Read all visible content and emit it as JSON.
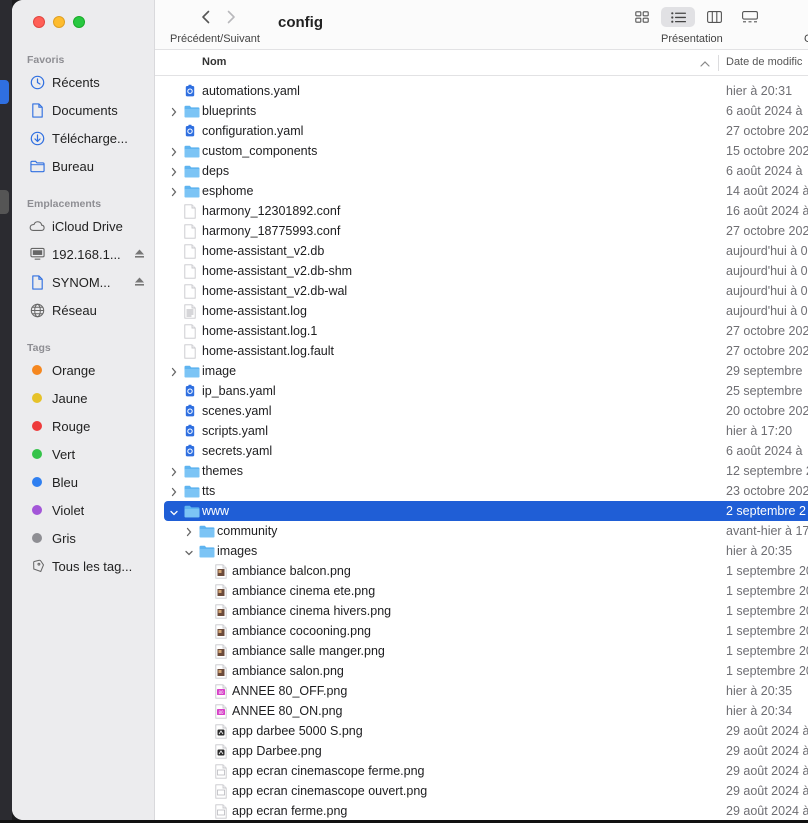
{
  "window": {
    "title": "config"
  },
  "toolbar": {
    "nav_label": "Précédent/Suivant",
    "presentation_label": "Présentation",
    "cut_label": "C",
    "view_modes": [
      {
        "name": "icon-view",
        "selected": false
      },
      {
        "name": "list-view",
        "selected": true
      },
      {
        "name": "column-view",
        "selected": false
      },
      {
        "name": "gallery-view",
        "selected": false
      }
    ]
  },
  "sidebar": {
    "favorites_label": "Favoris",
    "favorites": [
      {
        "label": "Récents",
        "icon": "clock-icon"
      },
      {
        "label": "Documents",
        "icon": "document-icon"
      },
      {
        "label": "Télécharge...",
        "icon": "download-icon"
      },
      {
        "label": "Bureau",
        "icon": "folder-icon"
      }
    ],
    "locations_label": "Emplacements",
    "locations": [
      {
        "label": "iCloud Drive",
        "icon": "cloud-icon",
        "eject": false
      },
      {
        "label": "192.168.1...",
        "icon": "display-icon",
        "eject": true
      },
      {
        "label": "SYNOM...",
        "icon": "document-icon",
        "eject": true
      },
      {
        "label": "Réseau",
        "icon": "globe-icon",
        "eject": false
      }
    ],
    "tags_label": "Tags",
    "tags": [
      {
        "label": "Orange",
        "color": "#f5871f"
      },
      {
        "label": "Jaune",
        "color": "#e6c229"
      },
      {
        "label": "Rouge",
        "color": "#ee3b3b"
      },
      {
        "label": "Vert",
        "color": "#35c34a"
      },
      {
        "label": "Bleu",
        "color": "#2f7ff0"
      },
      {
        "label": "Violet",
        "color": "#a356d8"
      },
      {
        "label": "Gris",
        "color": "#8e8e93"
      }
    ],
    "all_tags_label": "Tous les tag..."
  },
  "columns": {
    "name": "Nom",
    "date": "Date de modific"
  },
  "files": [
    {
      "name": "automations.yaml",
      "date": "hier à 20:31",
      "type": "yaml",
      "level": 0,
      "disc": "none"
    },
    {
      "name": "blueprints",
      "date": "6 août 2024 à",
      "type": "folder",
      "level": 0,
      "disc": "closed"
    },
    {
      "name": "configuration.yaml",
      "date": "27 octobre 202",
      "type": "yaml",
      "level": 0,
      "disc": "none"
    },
    {
      "name": "custom_components",
      "date": "15 octobre 202",
      "type": "folder",
      "level": 0,
      "disc": "closed"
    },
    {
      "name": "deps",
      "date": "6 août 2024 à",
      "type": "folder",
      "level": 0,
      "disc": "closed"
    },
    {
      "name": "esphome",
      "date": "14 août 2024 à",
      "type": "folder",
      "level": 0,
      "disc": "closed"
    },
    {
      "name": "harmony_12301892.conf",
      "date": "16 août 2024 à",
      "type": "file",
      "level": 0,
      "disc": "none"
    },
    {
      "name": "harmony_18775993.conf",
      "date": "27 octobre 202",
      "type": "file",
      "level": 0,
      "disc": "none"
    },
    {
      "name": "home-assistant_v2.db",
      "date": "aujourd'hui à 0",
      "type": "file",
      "level": 0,
      "disc": "none"
    },
    {
      "name": "home-assistant_v2.db-shm",
      "date": "aujourd'hui à 0",
      "type": "file",
      "level": 0,
      "disc": "none"
    },
    {
      "name": "home-assistant_v2.db-wal",
      "date": "aujourd'hui à 0",
      "type": "file",
      "level": 0,
      "disc": "none"
    },
    {
      "name": "home-assistant.log",
      "date": "aujourd'hui à 0",
      "type": "log",
      "level": 0,
      "disc": "none"
    },
    {
      "name": "home-assistant.log.1",
      "date": "27 octobre 202",
      "type": "file",
      "level": 0,
      "disc": "none"
    },
    {
      "name": "home-assistant.log.fault",
      "date": "27 octobre 202",
      "type": "file",
      "level": 0,
      "disc": "none"
    },
    {
      "name": "image",
      "date": "29 septembre",
      "type": "folder",
      "level": 0,
      "disc": "closed"
    },
    {
      "name": "ip_bans.yaml",
      "date": "25 septembre",
      "type": "yaml",
      "level": 0,
      "disc": "none"
    },
    {
      "name": "scenes.yaml",
      "date": "20 octobre 202",
      "type": "yaml",
      "level": 0,
      "disc": "none"
    },
    {
      "name": "scripts.yaml",
      "date": "hier à 17:20",
      "type": "yaml",
      "level": 0,
      "disc": "none"
    },
    {
      "name": "secrets.yaml",
      "date": "6 août 2024 à",
      "type": "yaml",
      "level": 0,
      "disc": "none"
    },
    {
      "name": "themes",
      "date": "12 septembre 2",
      "type": "folder",
      "level": 0,
      "disc": "closed"
    },
    {
      "name": "tts",
      "date": "23 octobre 202",
      "type": "folder",
      "level": 0,
      "disc": "closed"
    },
    {
      "name": "www",
      "date": "2 septembre 2",
      "type": "folder",
      "level": 0,
      "disc": "open",
      "selected": true
    },
    {
      "name": "community",
      "date": "avant-hier à 17",
      "type": "folder",
      "level": 1,
      "disc": "closed"
    },
    {
      "name": "images",
      "date": "hier à 20:35",
      "type": "folder",
      "level": 1,
      "disc": "open"
    },
    {
      "name": "ambiance balcon.png",
      "date": "1 septembre 20",
      "type": "image",
      "level": 2,
      "disc": "none"
    },
    {
      "name": "ambiance cinema ete.png",
      "date": "1 septembre 20",
      "type": "image",
      "level": 2,
      "disc": "none"
    },
    {
      "name": "ambiance cinema hivers.png",
      "date": "1 septembre 20",
      "type": "image",
      "level": 2,
      "disc": "none"
    },
    {
      "name": "ambiance cocooning.png",
      "date": "1 septembre 20",
      "type": "image",
      "level": 2,
      "disc": "none"
    },
    {
      "name": "ambiance salle manger.png",
      "date": "1 septembre 20",
      "type": "image",
      "level": 2,
      "disc": "none"
    },
    {
      "name": "ambiance salon.png",
      "date": "1 septembre 20",
      "type": "image",
      "level": 2,
      "disc": "none"
    },
    {
      "name": "ANNEE 80_OFF.png",
      "date": "hier à 20:35",
      "type": "image-pink",
      "level": 2,
      "disc": "none"
    },
    {
      "name": "ANNEE 80_ON.png",
      "date": "hier à 20:34",
      "type": "image-pink",
      "level": 2,
      "disc": "none"
    },
    {
      "name": "app darbee 5000 S.png",
      "date": "29 août 2024 à",
      "type": "image-dark",
      "level": 2,
      "disc": "none"
    },
    {
      "name": "app Darbee.png",
      "date": "29 août 2024 à",
      "type": "image-dark",
      "level": 2,
      "disc": "none"
    },
    {
      "name": "app ecran cinemascope ferme.png",
      "date": "29 août 2024 à",
      "type": "image-plain",
      "level": 2,
      "disc": "none"
    },
    {
      "name": "app ecran cinemascope ouvert.png",
      "date": "29 août 2024 à",
      "type": "image-plain",
      "level": 2,
      "disc": "none"
    },
    {
      "name": "app ecran ferme.png",
      "date": "29 août 2024 à",
      "type": "image-plain",
      "level": 2,
      "disc": "none"
    }
  ],
  "colors": {
    "accent": "#1f5ed6",
    "folder": "#5fb4f0",
    "yaml": "#2f6fe0"
  }
}
